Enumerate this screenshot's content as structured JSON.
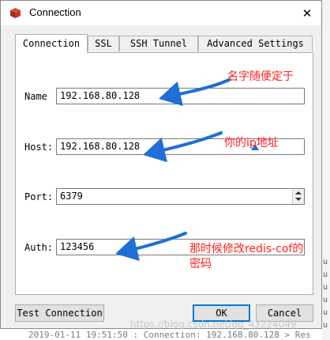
{
  "window": {
    "title": "Connection",
    "close_glyph": "✕",
    "icon": "redis-logo-icon"
  },
  "tabs": [
    {
      "label": "Connection",
      "active": true
    },
    {
      "label": "SSL",
      "active": false
    },
    {
      "label": "SSH Tunnel",
      "active": false
    },
    {
      "label": "Advanced Settings",
      "active": false
    }
  ],
  "form": {
    "name": {
      "label": "Name",
      "value": "192.168.80.128"
    },
    "host": {
      "label": "Host:",
      "value": "192.168.80.128"
    },
    "port": {
      "label": "Port:",
      "value": "6379"
    },
    "auth": {
      "label": "Auth:",
      "value": "123456"
    }
  },
  "buttons": {
    "test": "Test Connection",
    "ok": "OK",
    "cancel": "Cancel"
  },
  "annotations": {
    "name_note": "名字随便定于",
    "host_note": "你的ip地址",
    "auth_note_line1": "那时候修改redis-cof的",
    "auth_note_line2": "密码",
    "color": "#ff2020",
    "arrow_color": "#1f6fd6"
  },
  "background": {
    "log_line": "2019-01-11 19:51:50 : Connection: 192.168.80.128 > Res",
    "side_chars": [
      "u",
      "u",
      "u",
      "u",
      "u",
      "u"
    ]
  },
  "watermark": "https://blog.csdn.net/qq_43224049"
}
